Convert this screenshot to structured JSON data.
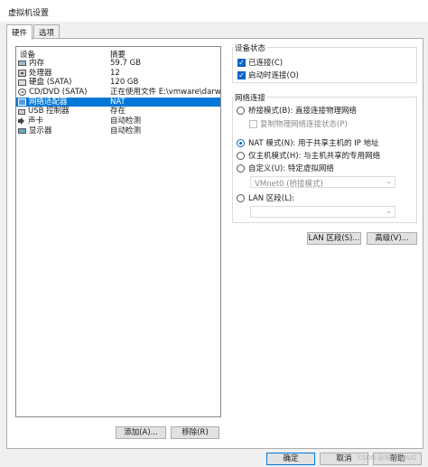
{
  "window": {
    "title": "虚拟机设置"
  },
  "tabs": [
    {
      "label": "硬件"
    },
    {
      "label": "选项"
    }
  ],
  "devices": {
    "columns": {
      "device": "设备",
      "summary": "摘要"
    },
    "rows": [
      {
        "name": "内存",
        "summary": "59.7 GB",
        "icon": "memory-icon"
      },
      {
        "name": "处理器",
        "summary": "12",
        "icon": "cpu-icon"
      },
      {
        "name": "硬盘 (SATA)",
        "summary": "120 GB",
        "icon": "hard-disk-icon"
      },
      {
        "name": "CD/DVD (SATA)",
        "summary": "正在使用文件 E:\\vmware\\darwi...",
        "icon": "cd-dvd-icon"
      },
      {
        "name": "网络适配器",
        "summary": "NAT",
        "icon": "network-adapter-icon"
      },
      {
        "name": "USB 控制器",
        "summary": "存在",
        "icon": "usb-icon"
      },
      {
        "name": "声卡",
        "summary": "自动检测",
        "icon": "sound-icon"
      },
      {
        "name": "显示器",
        "summary": "自动检测",
        "icon": "display-icon"
      }
    ],
    "selected_index": 4,
    "add_label": "添加(A)...",
    "remove_label": "移除(R)"
  },
  "device_status": {
    "title": "设备状态",
    "connected": {
      "label": "已连接(C)",
      "checked": true
    },
    "connect_at_power_on": {
      "label": "启动时连接(O)",
      "checked": true
    }
  },
  "network_connection": {
    "title": "网络连接",
    "bridged": {
      "label": "桥接模式(B): 直接连接物理网络",
      "selected": false
    },
    "replicate": {
      "label": "复制物理网络连接状态(P)",
      "checked": false,
      "enabled": false
    },
    "nat": {
      "label": "NAT 模式(N): 用于共享主机的 IP 地址",
      "selected": true
    },
    "host_only": {
      "label": "仅主机模式(H): 与主机共享的专用网络",
      "selected": false
    },
    "custom": {
      "label": "自定义(U): 特定虚拟网络",
      "selected": false
    },
    "custom_select_value": "VMnet0 (桥接模式)",
    "lan_segment": {
      "label": "LAN 区段(L):",
      "selected": false
    },
    "lan_select_value": ""
  },
  "buttons": {
    "lan_segments": "LAN 区段(S)...",
    "advanced": "高级(V)...",
    "ok": "确定",
    "cancel": "取消",
    "help": "帮助"
  },
  "watermark": "CSDN @攻城狮BUG"
}
